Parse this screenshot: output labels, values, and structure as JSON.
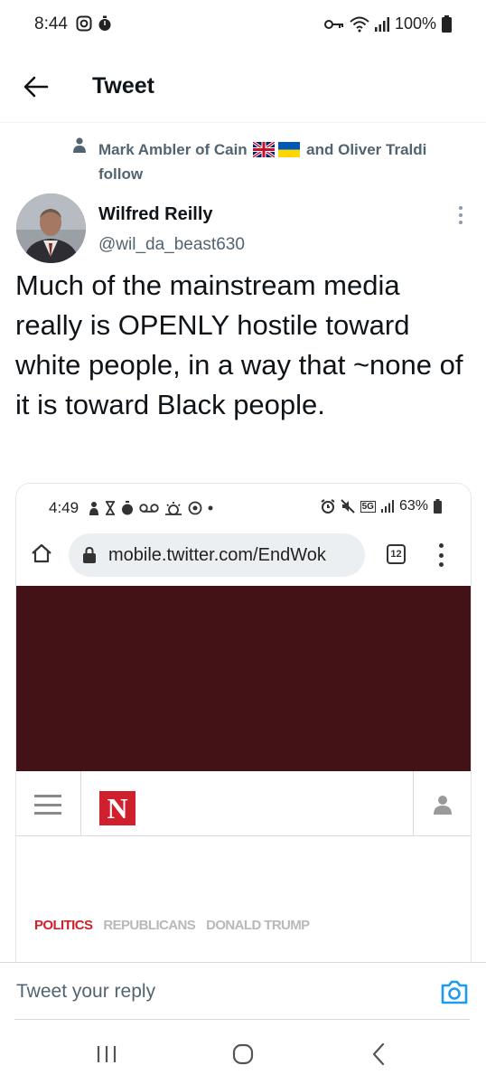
{
  "status_bar": {
    "time": "8:44",
    "battery": "100%",
    "left_icons": [
      "instagram-icon",
      "timer-icon"
    ],
    "right_icons": [
      "key-icon",
      "wifi-icon",
      "signal-icon",
      "battery-icon"
    ]
  },
  "header": {
    "title": "Tweet",
    "back_icon": "back-arrow-icon"
  },
  "social_context": {
    "name_part1": "Mark Ambler of Cain",
    "name_part2": "and Oliver Traldi",
    "suffix": "follow",
    "flags": [
      "uk-flag-icon",
      "ukraine-flag-icon"
    ]
  },
  "author": {
    "name": "Wilfred Reilly",
    "handle": "@wil_da_beast630"
  },
  "tweet": {
    "text": "Much of the mainstream media really is OPENLY hostile toward white people, in a way that ~none of it is toward Black people."
  },
  "media": {
    "status_time": "4:49",
    "battery": "63%",
    "network": "5G",
    "url": "mobile.twitter.com/EndWok",
    "tab_count": "12",
    "banner_color": "#431216",
    "logo_letter": "N",
    "logo_color": "#d0202e",
    "tags": [
      "POLITICS",
      "REPUBLICANS",
      "DONALD TRUMP"
    ]
  },
  "reply": {
    "placeholder": "Tweet your reply"
  },
  "colors": {
    "accent": "#1d9bf0",
    "secondary_text": "#536471",
    "primary_text": "#0f1419"
  }
}
